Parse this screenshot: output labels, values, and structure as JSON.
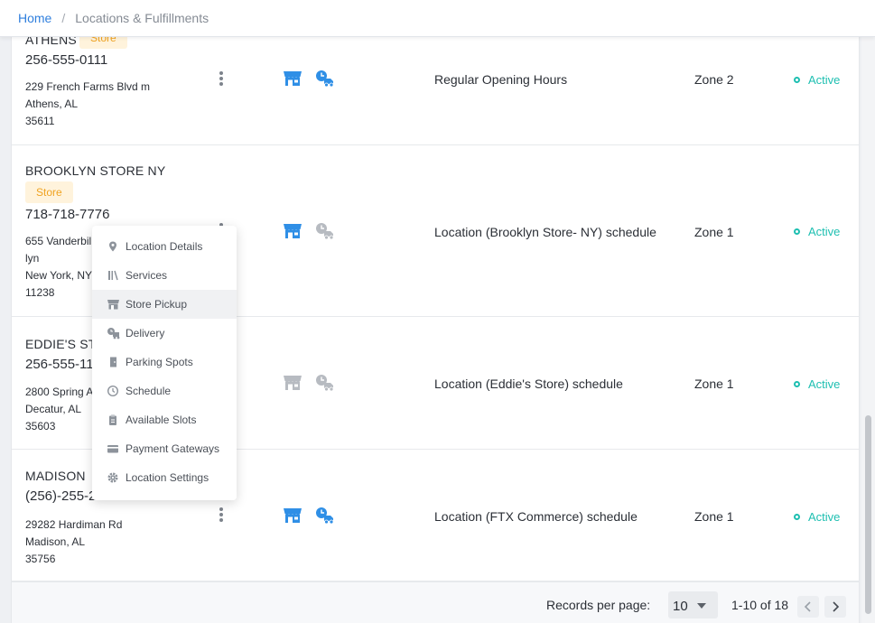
{
  "breadcrumb": {
    "home": "Home",
    "separator": "/",
    "current": "Locations & Fulfillments"
  },
  "locations": [
    {
      "name": "ATHENS",
      "badge": "Store",
      "phone": "256-555-0111",
      "address": [
        "229 French Farms Blvd m",
        "Athens, AL",
        "35611"
      ],
      "store_pickup": true,
      "delivery": true,
      "schedule": "Regular Opening Hours",
      "zone": "Zone 2",
      "status": "Active"
    },
    {
      "name": "BROOKLYN STORE NY",
      "badge": "Store",
      "phone": "718-718-7776",
      "address": [
        "655 Vanderbil",
        "lyn",
        "New York, NY",
        "11238"
      ],
      "store_pickup": true,
      "delivery": false,
      "schedule": "Location (Brooklyn Store- NY) schedule",
      "zone": "Zone 1",
      "status": "Active"
    },
    {
      "name": "EDDIE'S STO",
      "badge": "",
      "phone": "256-555-11",
      "address": [
        "2800 Spring A",
        "Decatur, AL",
        "35603"
      ],
      "store_pickup": false,
      "delivery": false,
      "schedule": "Location (Eddie's Store) schedule",
      "zone": "Zone 1",
      "status": "Active"
    },
    {
      "name": "MADISON",
      "badge": "",
      "phone": "(256)-255-2",
      "address": [
        "29282 Hardiman Rd",
        "Madison, AL",
        "35756"
      ],
      "store_pickup": true,
      "delivery": true,
      "schedule": "Location (FTX Commerce) schedule",
      "zone": "Zone 1",
      "status": "Active"
    }
  ],
  "context_menu": {
    "items": [
      {
        "label": "Location Details",
        "icon": "map-pin-icon"
      },
      {
        "label": "Services",
        "icon": "services-icon"
      },
      {
        "label": "Store Pickup",
        "icon": "store-icon",
        "highlighted": true
      },
      {
        "label": "Delivery",
        "icon": "delivery-truck-icon"
      },
      {
        "label": "Parking Spots",
        "icon": "parking-door-icon"
      },
      {
        "label": "Schedule",
        "icon": "clock-icon"
      },
      {
        "label": "Available Slots",
        "icon": "clipboard-icon"
      },
      {
        "label": "Payment Gateways",
        "icon": "credit-card-icon"
      },
      {
        "label": "Location Settings",
        "icon": "gear-icon"
      }
    ]
  },
  "pagination": {
    "records_label": "Records per page:",
    "per_page": "10",
    "range": "1-10 of 18"
  },
  "colors": {
    "accent": "#2f7fdd",
    "service_active": "#2f8fe6",
    "service_inactive": "#b7bbc1",
    "status_active": "#1ebfb1",
    "badge_text": "#f0a321",
    "badge_bg": "#fff3dc"
  }
}
